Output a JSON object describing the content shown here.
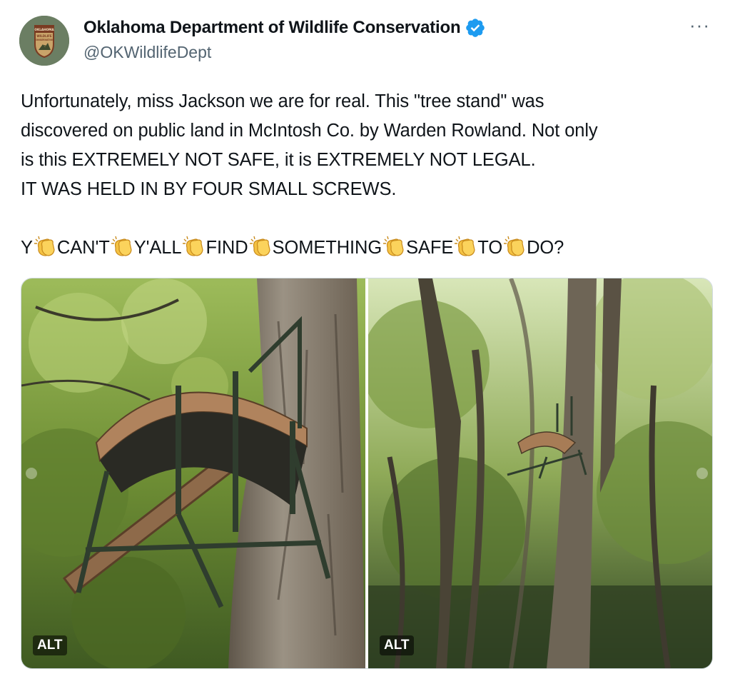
{
  "account": {
    "display_name": "Oklahoma Department of Wildlife Conservation",
    "handle": "@OKWildlifeDept",
    "verified": true,
    "avatar_icon": "agency-seal-icon",
    "avatar_text_top": "OKLAHOMA",
    "avatar_text_mid": "WILDLIFE",
    "avatar_text_bot": "CONSERVATION"
  },
  "menu": {
    "more_label": "···"
  },
  "tweet": {
    "lines": [
      "Unfortunately, miss Jackson we are for real. This \"tree stand\" was",
      "discovered on public land in McIntosh Co. by Warden Rowland. Not only",
      "is this EXTREMELY NOT SAFE, it is EXTREMELY NOT LEGAL.",
      "IT WAS HELD IN BY FOUR SMALL SCREWS."
    ],
    "clap_words": [
      "Y",
      "CAN'T",
      "Y'ALL",
      "FIND",
      "SOMETHING",
      "SAFE",
      "TO",
      "DO?"
    ],
    "clap_icon": "clapping-hands-icon"
  },
  "media": {
    "photos": [
      {
        "alt_label": "ALT",
        "subject": "tree-stand-closeup"
      },
      {
        "alt_label": "ALT",
        "subject": "tree-stand-wide"
      }
    ]
  },
  "colors": {
    "text": "#0f1419",
    "secondary": "#536471",
    "verified": "#1d9bf0",
    "border": "#cfd9de"
  }
}
